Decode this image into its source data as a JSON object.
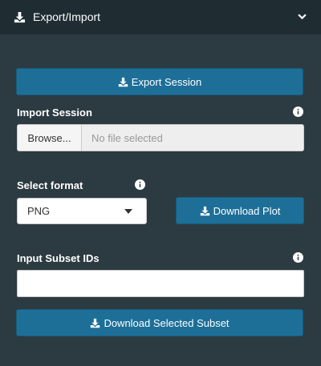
{
  "header": {
    "title": "Export/Import",
    "icon": "download-icon",
    "toggle_icon": "chevron-down-icon"
  },
  "export_button": {
    "label": "Export Session",
    "icon": "download-icon"
  },
  "import": {
    "label": "Import Session",
    "browse_label": "Browse...",
    "placeholder": "No file selected",
    "info_icon": "info-circle-icon"
  },
  "format": {
    "label": "Select format",
    "selected": "PNG",
    "info_icon": "info-circle-icon"
  },
  "download_plot_button": {
    "label": "Download Plot",
    "icon": "download-icon"
  },
  "subset": {
    "label": "Input Subset IDs",
    "value": "",
    "info_icon": "info-circle-icon"
  },
  "download_subset_button": {
    "label": "Download Selected Subset",
    "icon": "download-icon"
  },
  "colors": {
    "panel_bg": "#2c3b41",
    "header_bg": "#1f2d33",
    "button_bg": "#1d6f98"
  }
}
